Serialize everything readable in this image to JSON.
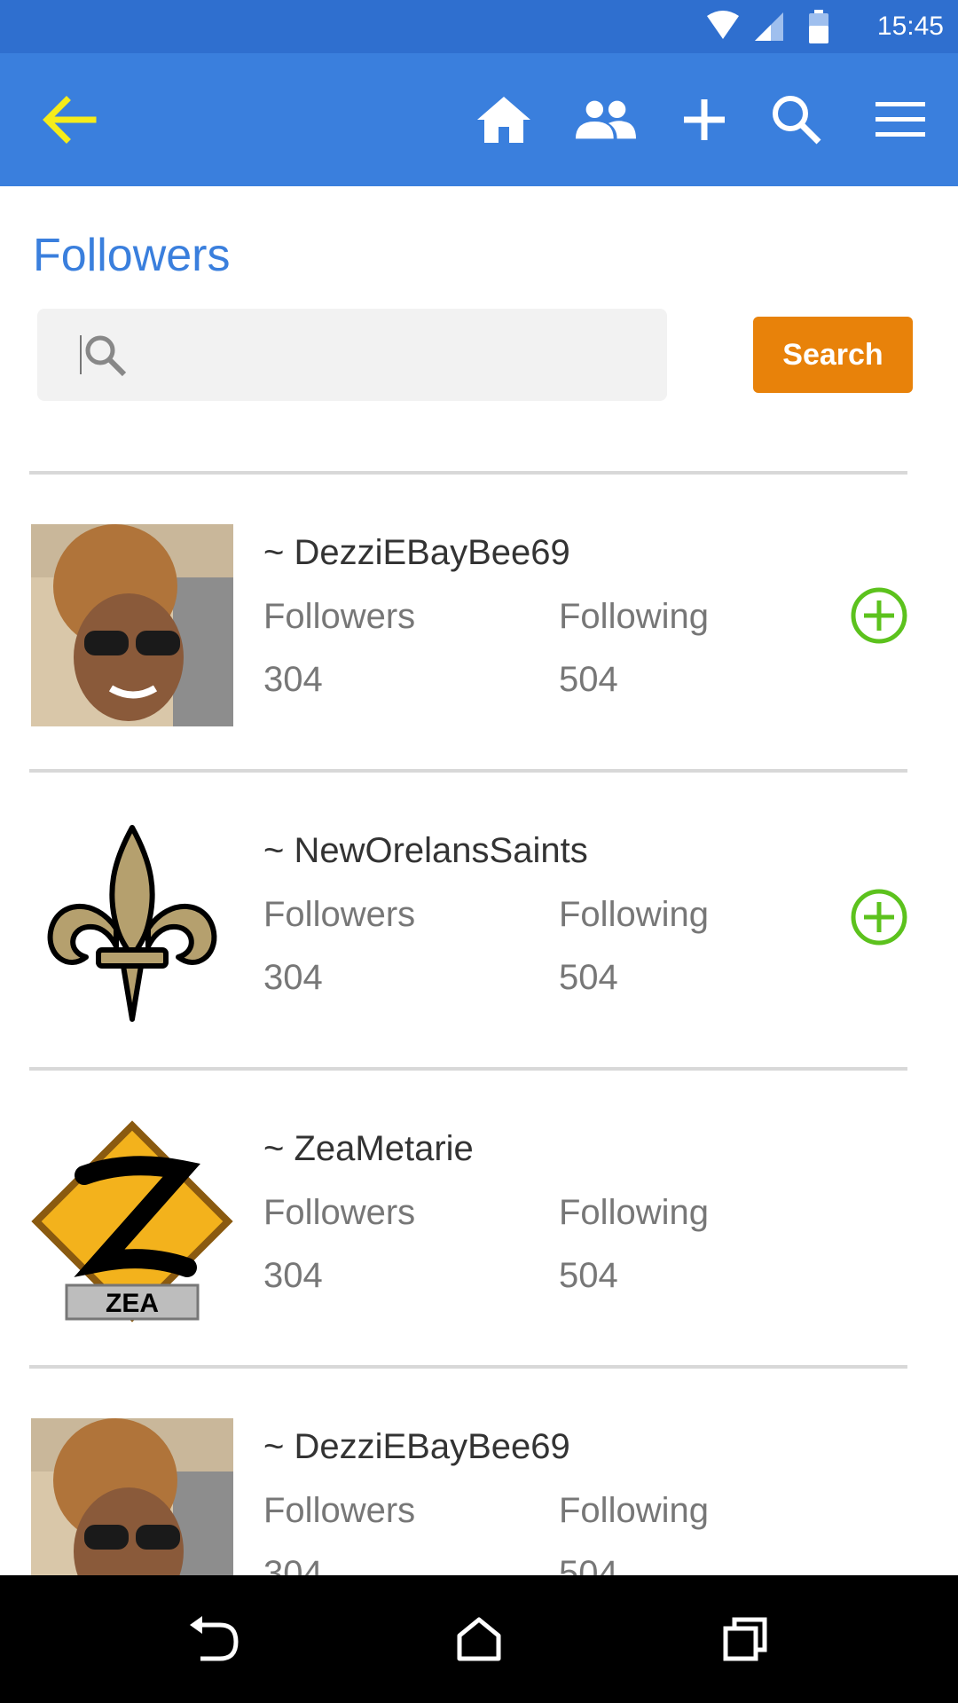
{
  "status": {
    "time": "15:45"
  },
  "page": {
    "title": "Followers"
  },
  "search": {
    "placeholder": "",
    "value": "",
    "button_label": "Search"
  },
  "stats": {
    "followers_label": "Followers",
    "following_label": "Following"
  },
  "users": [
    {
      "name": "~ DezziEBayBee69",
      "followers": "304",
      "following": "504",
      "has_add": true
    },
    {
      "name": "~ NewOrelansSaints",
      "followers": "304",
      "following": "504",
      "has_add": true
    },
    {
      "name": "~ ZeaMetarie",
      "followers": "304",
      "following": "504",
      "has_add": false,
      "logo_text": "ZEA"
    },
    {
      "name": "~ DezziEBayBee69",
      "followers": "304",
      "following": "504",
      "has_add": false
    }
  ],
  "colors": {
    "appbar": "#3a7fdd",
    "accent_yellow": "#f5ec1a",
    "search_button": "#e8820a",
    "add_green": "#5cc21d"
  },
  "icons": [
    "back-arrow-icon",
    "home-icon",
    "people-icon",
    "plus-icon",
    "search-icon",
    "menu-icon",
    "add-circle-icon",
    "nav-back-icon",
    "nav-home-icon",
    "nav-recents-icon"
  ]
}
